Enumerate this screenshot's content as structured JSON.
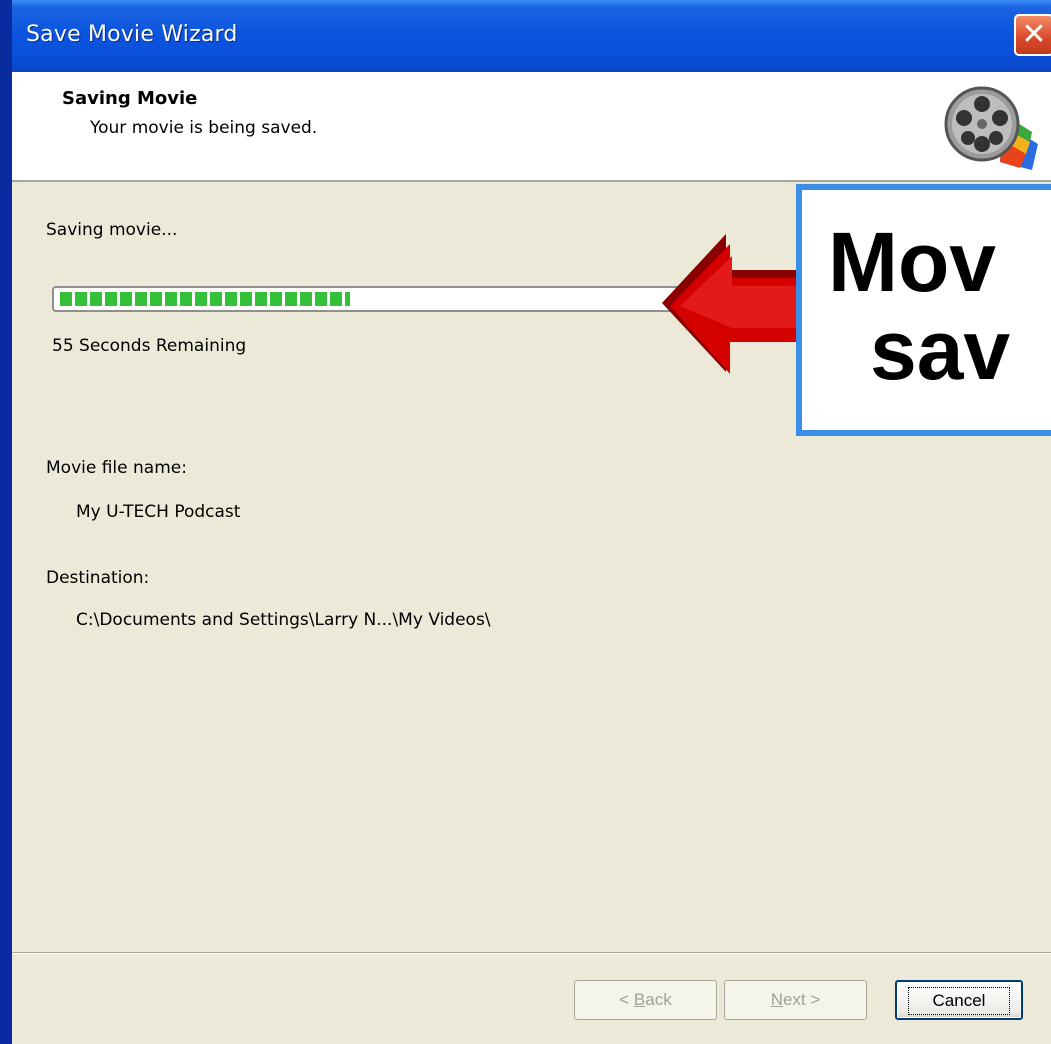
{
  "window": {
    "title": "Save Movie Wizard",
    "close_glyph": "✕"
  },
  "header": {
    "title": "Saving Movie",
    "subtitle": "Your movie is being saved.",
    "icon": "movie-reel-icon"
  },
  "progress": {
    "label": "Saving movie...",
    "fraction": 0.45,
    "remaining": "55 Seconds Remaining"
  },
  "file": {
    "name_label": "Movie file name:",
    "name_value": "My U-TECH Podcast",
    "dest_label": "Destination:",
    "dest_value": "C:\\Documents and Settings\\Larry N...\\My Videos\\"
  },
  "buttons": {
    "back_prefix": "< ",
    "back_underlined": "B",
    "back_rest": "ack",
    "next_underlined": "N",
    "next_rest": "ext >",
    "cancel": "Cancel"
  },
  "callout": {
    "line1": "Mov",
    "line2": "sav",
    "arrow_color": "#cc0000",
    "border_color": "#3b8ee8"
  }
}
